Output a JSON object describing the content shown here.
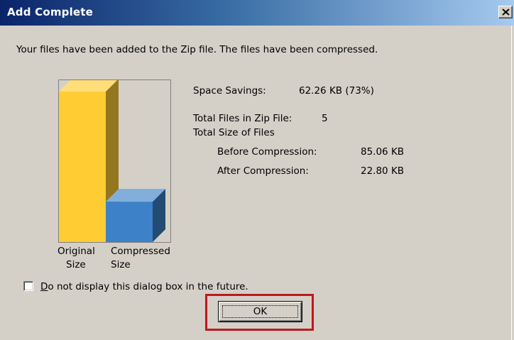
{
  "window": {
    "title": "Add Complete",
    "close_glyph": "✕"
  },
  "message": "Your files have been added to the Zip file. The files have been compressed.",
  "stats": {
    "space_savings_label": "Space Savings:",
    "space_savings_value": "62.26 KB (73%)",
    "total_files_label": "Total Files in Zip File:",
    "total_files_value": "5",
    "total_size_label": "Total Size of Files",
    "before_label": "Before Compression:",
    "before_value": "85.06 KB",
    "after_label": "After Compression:",
    "after_value": "22.80 KB"
  },
  "chart_data": {
    "type": "bar",
    "categories": [
      "Original Size",
      "Compressed Size"
    ],
    "category_lines": [
      [
        "Original",
        "Size"
      ],
      [
        "Compressed",
        "Size"
      ]
    ],
    "values": [
      85.06,
      22.8
    ],
    "unit": "KB",
    "colors": [
      "#ffcc33",
      "#3d82c8"
    ]
  },
  "checkbox": {
    "label_accel": "D",
    "label_rest": "o not display this dialog box in the future.",
    "checked": false
  },
  "ok_button": {
    "label": "OK"
  },
  "colors": {
    "title_bar_start": "#0a246a",
    "title_bar_end": "#a6caf0",
    "dialog_bg": "#d4d0c8",
    "highlight": "#c0191c"
  }
}
